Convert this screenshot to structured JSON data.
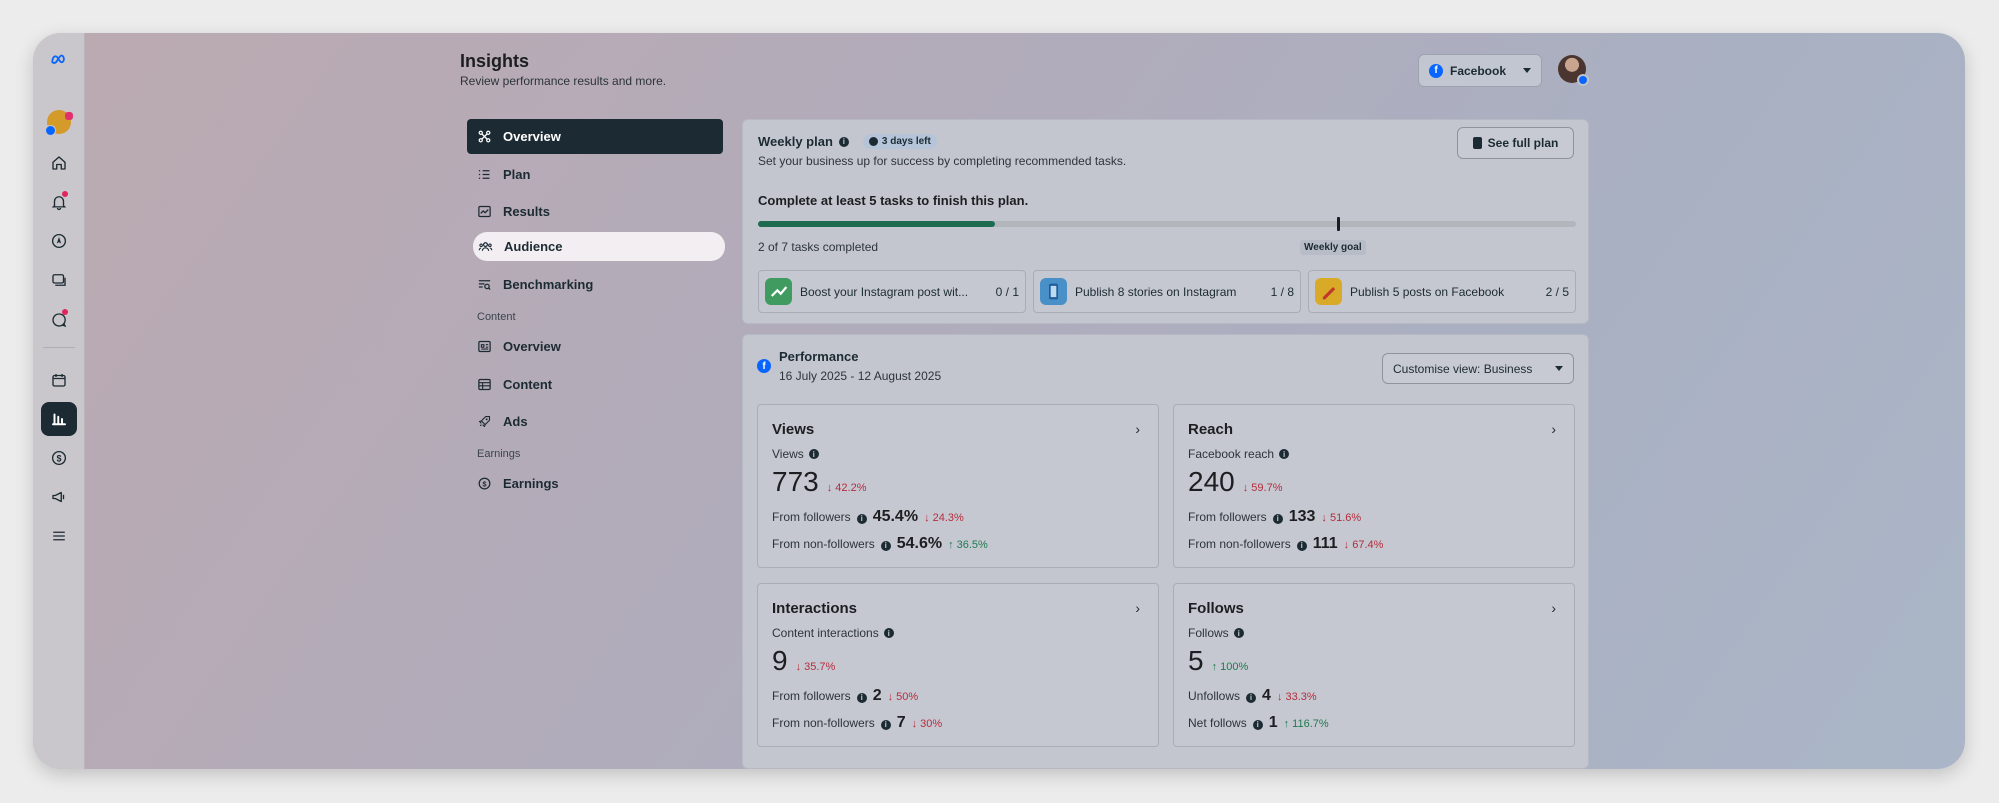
{
  "header": {
    "title": "Insights",
    "subtitle": "Review performance results and more.",
    "platform": "Facebook"
  },
  "nav": {
    "items": [
      {
        "label": "Overview",
        "icon": "overview-icon"
      },
      {
        "label": "Plan",
        "icon": "list-icon"
      },
      {
        "label": "Results",
        "icon": "chart-line-icon"
      },
      {
        "label": "Audience",
        "icon": "people-icon"
      },
      {
        "label": "Benchmarking",
        "icon": "benchmark-icon"
      }
    ],
    "content_section": "Content",
    "content_items": [
      {
        "label": "Overview",
        "icon": "content-overview-icon"
      },
      {
        "label": "Content",
        "icon": "grid-icon"
      },
      {
        "label": "Ads",
        "icon": "rocket-icon"
      }
    ],
    "earnings_section": "Earnings",
    "earnings_items": [
      {
        "label": "Earnings",
        "icon": "dollar-icon"
      }
    ]
  },
  "plan": {
    "title": "Weekly plan",
    "badge": "3 days left",
    "description": "Set your business up for success by completing recommended tasks.",
    "see_full_plan": "See full plan",
    "goal_text": "Complete at least 5 tasks to finish this plan.",
    "tasks_completed": "2 of 7 tasks completed",
    "progress_fraction": 0.29,
    "weekly_goal_label": "Weekly goal",
    "tasks": [
      {
        "name": "Boost your Instagram post wit...",
        "progress": "0 / 1"
      },
      {
        "name": "Publish 8 stories on Instagram",
        "progress": "1 / 8"
      },
      {
        "name": "Publish 5 posts on Facebook",
        "progress": "2 / 5"
      }
    ]
  },
  "performance": {
    "title": "Performance",
    "date_range": "16 July 2025 - 12 August 2025",
    "customise": "Customise view: Business",
    "views": {
      "title": "Views",
      "sub": "Views",
      "value": "773",
      "change": "42.2%",
      "row1_label": "From followers",
      "row1_value": "45.4%",
      "row1_change": "24.3%",
      "row2_label": "From non-followers",
      "row2_value": "54.6%",
      "row2_change": "36.5%"
    },
    "reach": {
      "title": "Reach",
      "sub": "Facebook reach",
      "value": "240",
      "change": "59.7%",
      "row1_label": "From followers",
      "row1_value": "133",
      "row1_change": "51.6%",
      "row2_label": "From non-followers",
      "row2_value": "111",
      "row2_change": "67.4%"
    },
    "interactions": {
      "title": "Interactions",
      "sub": "Content interactions",
      "value": "9",
      "change": "35.7%",
      "row1_label": "From followers",
      "row1_value": "2",
      "row1_change": "50%",
      "row2_label": "From non-followers",
      "row2_value": "7",
      "row2_change": "30%"
    },
    "follows": {
      "title": "Follows",
      "sub": "Follows",
      "value": "5",
      "change": "100%",
      "row1_label": "Unfollows",
      "row1_value": "4",
      "row1_change": "33.3%",
      "row2_label": "Net follows",
      "row2_value": "1",
      "row2_change": "116.7%"
    }
  },
  "colors": {
    "accent_dark": "#1c2b33",
    "progress_green": "#1e6b52",
    "down_red": "#b42d3c",
    "up_green": "#1e7a4f",
    "facebook_blue": "#0866ff"
  }
}
